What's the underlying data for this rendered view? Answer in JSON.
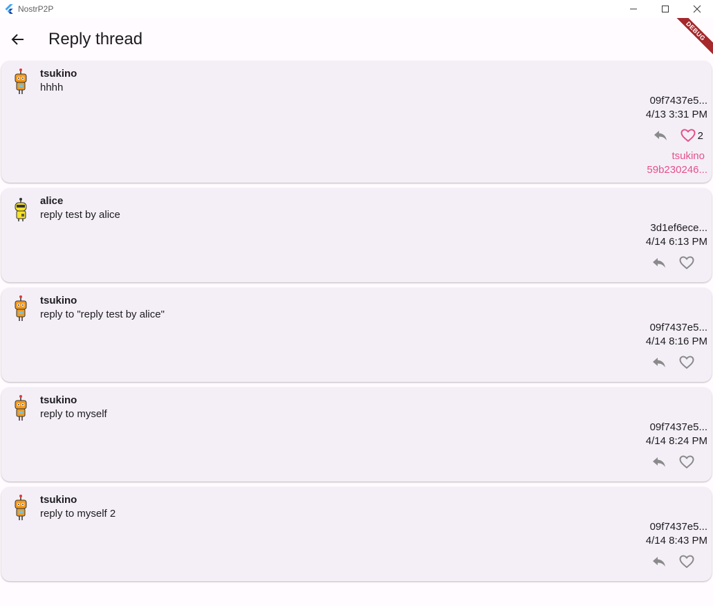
{
  "window": {
    "title": "NostrP2P"
  },
  "appbar": {
    "title": "Reply thread",
    "debug_label": "DEBUG"
  },
  "colors": {
    "card_bg": "#f4eff7",
    "liked_heart": "#e4508b",
    "icon_grey": "#8a8a8a",
    "debug_ribbon": "#a4282c"
  },
  "posts": [
    {
      "author": "tsukino",
      "content": "hhhh",
      "pubkey": "09f7437e5...",
      "time": "4/13 3:31 PM",
      "liked": true,
      "like_count": "2",
      "liked_by_name": "tsukino",
      "liked_by_key": "59b230246...",
      "avatar": "robot-orange-avatar"
    },
    {
      "author": "alice",
      "content": "reply test by alice",
      "pubkey": "3d1ef6ece...",
      "time": "4/14 6:13 PM",
      "liked": false,
      "avatar": "robot-yellow-avatar"
    },
    {
      "author": "tsukino",
      "content": "reply to \"reply test by alice\"",
      "pubkey": "09f7437e5...",
      "time": "4/14 8:16 PM",
      "liked": false,
      "avatar": "robot-orange-avatar"
    },
    {
      "author": "tsukino",
      "content": "reply to myself",
      "pubkey": "09f7437e5...",
      "time": "4/14 8:24 PM",
      "liked": false,
      "avatar": "robot-orange-avatar"
    },
    {
      "author": "tsukino",
      "content": "reply to myself 2",
      "pubkey": "09f7437e5...",
      "time": "4/14 8:43 PM",
      "liked": false,
      "avatar": "robot-orange-avatar"
    }
  ]
}
